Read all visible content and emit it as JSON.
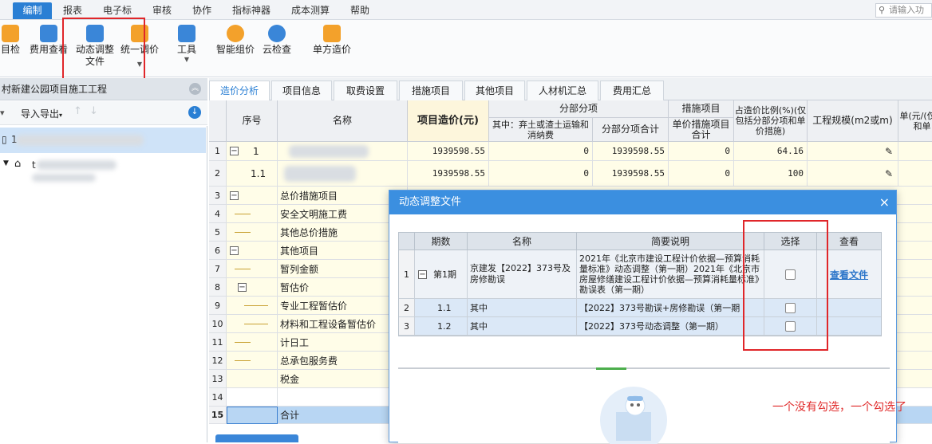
{
  "menu": {
    "items": [
      "编制",
      "报表",
      "电子标",
      "审核",
      "协作",
      "指标神器",
      "成本测算",
      "帮助"
    ],
    "search_placeholder": "请输入功"
  },
  "toolbar": {
    "items": [
      {
        "label": "目检"
      },
      {
        "label": "费用查看"
      },
      {
        "label": "动态调整",
        "label2": "文件"
      },
      {
        "label": "统一调价"
      },
      {
        "label": "工具"
      },
      {
        "label": "智能组价"
      },
      {
        "label": "云检查"
      },
      {
        "label": "单方造价"
      }
    ]
  },
  "left_panel": {
    "title": "村新建公园项目施工工程",
    "import_export": "导入导出",
    "tree_row1": "1",
    "tree_row2": "t"
  },
  "tabs": [
    "造价分析",
    "项目信息",
    "取费设置",
    "措施项目",
    "其他项目",
    "人材机汇总",
    "费用汇总"
  ],
  "grid": {
    "headers": {
      "seq": "序号",
      "name": "名称",
      "project_cost": "项目造价(元)",
      "sub_section": "分部分项",
      "sub_a": "其中：弃土或渣土运输和消纳费",
      "sub_b": "分部分项合计",
      "measures": "措施项目",
      "measures_sub": "单价措施项目合计",
      "ratio": "占造价比例(%)(仅包括分部分项和单价措施)",
      "scale": "工程规模(m2或m)",
      "unit_price": "单(元/(仅包和单"
    },
    "rows": [
      {
        "rn": "1",
        "seq": "1",
        "name": "",
        "cost": "1939598.55",
        "earth": "0",
        "subtotal": "1939598.55",
        "measure": "0",
        "ratio": "64.16"
      },
      {
        "rn": "2",
        "seq": "1.1",
        "name": "",
        "cost": "1939598.55",
        "earth": "0",
        "subtotal": "1939598.55",
        "measure": "0",
        "ratio": "100"
      },
      {
        "rn": "3",
        "seq": "",
        "name": "总价措施项目"
      },
      {
        "rn": "4",
        "seq": "",
        "name": "安全文明施工费"
      },
      {
        "rn": "5",
        "seq": "",
        "name": "其他总价措施"
      },
      {
        "rn": "6",
        "seq": "",
        "name": "其他项目"
      },
      {
        "rn": "7",
        "seq": "",
        "name": "暂列金额"
      },
      {
        "rn": "8",
        "seq": "",
        "name": "暂估价"
      },
      {
        "rn": "9",
        "seq": "",
        "name": "专业工程暂估价"
      },
      {
        "rn": "10",
        "seq": "",
        "name": "材料和工程设备暂估价"
      },
      {
        "rn": "11",
        "seq": "",
        "name": "计日工"
      },
      {
        "rn": "12",
        "seq": "",
        "name": "总承包服务费"
      },
      {
        "rn": "13",
        "seq": "",
        "name": "税金"
      },
      {
        "rn": "14",
        "seq": "",
        "name": ""
      },
      {
        "rn": "15",
        "seq": "",
        "name": "合计"
      }
    ]
  },
  "dialog": {
    "title": "动态调整文件",
    "close": "×",
    "headers": {
      "period": "期数",
      "name": "名称",
      "desc": "简要说明",
      "select": "选择",
      "view": "查看"
    },
    "rows": [
      {
        "rn": "1",
        "period": "第1期",
        "name": "京建发【2022】373号及房修勘误",
        "desc": "2021年《北京市建设工程计价依据—预算消耗量标准》动态调整（第一期）2021年《北京市房屋修缮建设工程计价依据—预算消耗量标准》勘误表（第一期）",
        "view": "查看文件"
      },
      {
        "rn": "2",
        "period": "1.1",
        "name": "其中",
        "desc": "【2022】373号勘误+房修勘误（第一期",
        "view": ""
      },
      {
        "rn": "3",
        "period": "1.2",
        "name": "其中",
        "desc": "【2022】373号动态调整（第一期）",
        "view": ""
      }
    ]
  },
  "annotation": "一个没有勾选，一个勾选了",
  "colors": {
    "accent": "#2a7fd4",
    "red": "#e0262a",
    "dialog_title": "#3b8fe0"
  }
}
